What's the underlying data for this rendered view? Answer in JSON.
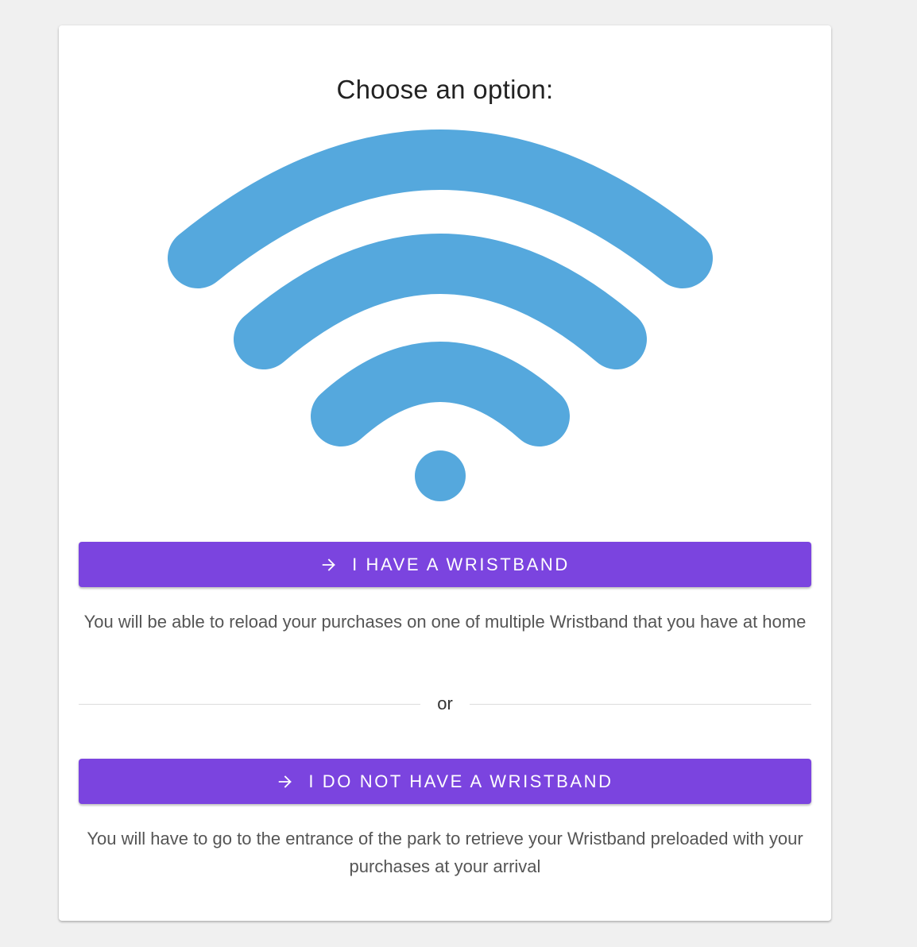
{
  "title": "Choose an option:",
  "icon": "wifi-icon",
  "colors": {
    "page_background": "#f0f0f0",
    "card_background": "#ffffff",
    "wifi": "#55a8dd",
    "button": "#7b44df",
    "button_text": "#ffffff"
  },
  "options": [
    {
      "button_label": "I HAVE A WRISTBAND",
      "button_icon": "arrow-right-icon",
      "description": "You will be able to reload your purchases on one of multiple Wristband that you have at home"
    },
    {
      "button_label": "I DO NOT HAVE A WRISTBAND",
      "button_icon": "arrow-right-icon",
      "description": "You will have to go to the entrance of the park to retrieve your Wristband preloaded with your purchases at your arrival"
    }
  ],
  "divider_text": "or"
}
